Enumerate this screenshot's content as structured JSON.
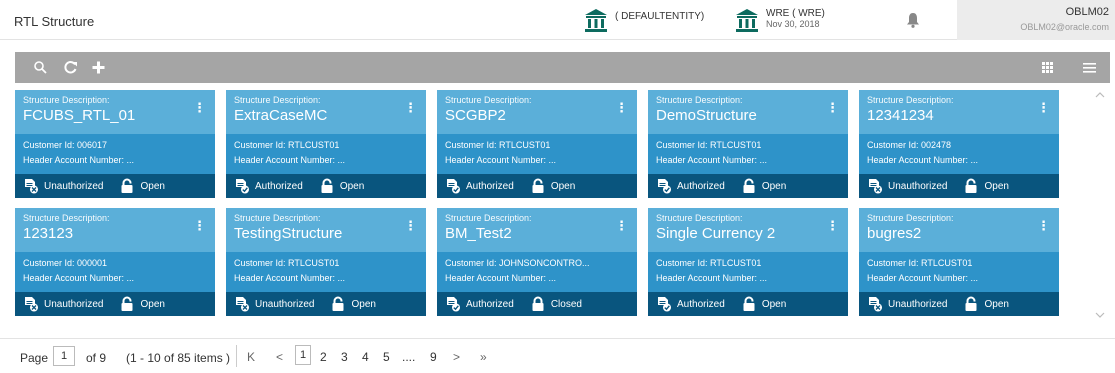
{
  "header": {
    "title": "RTL Structure",
    "entity1": {
      "name": "( DEFAULTENTITY)"
    },
    "entity2": {
      "name": "WRE ( WRE)",
      "date": "Nov 30, 2018"
    },
    "user": {
      "name": "OBLM02",
      "email": "OBLM02@oracle.com"
    }
  },
  "toolbar": {
    "icons": [
      "search-icon",
      "refresh-icon",
      "add-icon",
      "grid-view-icon",
      "list-view-icon"
    ]
  },
  "cards": [
    {
      "label": "Structure Description:",
      "name": "FCUBS_RTL_01",
      "customer": "Customer Id: 006017",
      "account": "Header Account Number: ...",
      "auth": "Unauthorized",
      "status": "Open"
    },
    {
      "label": "Structure Description:",
      "name": "ExtraCaseMC",
      "customer": "Customer Id: RTLCUST01",
      "account": "Header Account Number: ...",
      "auth": "Authorized",
      "status": "Open"
    },
    {
      "label": "Structure Description:",
      "name": "SCGBP2",
      "customer": "Customer Id: RTLCUST01",
      "account": "Header Account Number: ...",
      "auth": "Authorized",
      "status": "Open"
    },
    {
      "label": "Structure Description:",
      "name": "DemoStructure",
      "customer": "Customer Id: RTLCUST01",
      "account": "Header Account Number: ...",
      "auth": "Authorized",
      "status": "Open"
    },
    {
      "label": "Structure Description:",
      "name": "12341234",
      "customer": "Customer Id: 002478",
      "account": "Header Account Number: ...",
      "auth": "Unauthorized",
      "status": "Open"
    },
    {
      "label": "Structure Description:",
      "name": "123123",
      "customer": "Customer Id: 000001",
      "account": "Header Account Number: ...",
      "auth": "Unauthorized",
      "status": "Open"
    },
    {
      "label": "Structure Description:",
      "name": "TestingStructure",
      "customer": "Customer Id: RTLCUST01",
      "account": "Header Account Number: ...",
      "auth": "Unauthorized",
      "status": "Open"
    },
    {
      "label": "Structure Description:",
      "name": "BM_Test2",
      "customer": "Customer Id: JOHNSONCONTRO...",
      "account": "Header Account Number: ...",
      "auth": "Authorized",
      "status": "Closed"
    },
    {
      "label": "Structure Description:",
      "name": "Single Currency 2",
      "customer": "Customer Id: RTLCUST01",
      "account": "Header Account Number: ...",
      "auth": "Authorized",
      "status": "Open"
    },
    {
      "label": "Structure Description:",
      "name": "bugres2",
      "customer": "Customer Id: RTLCUST01",
      "account": "Header Account Number: ...",
      "auth": "Unauthorized",
      "status": "Open"
    }
  ],
  "pager": {
    "page_label": "Page",
    "current": "1",
    "of": "of 9",
    "summary": "(1 - 10 of 85 items )",
    "first": "K",
    "prev": "<",
    "pages": [
      "1",
      "2",
      "3",
      "4",
      "5",
      "....",
      "9"
    ],
    "next": ">",
    "last": "»"
  },
  "colors": {
    "card_top": "#5bafd9",
    "card_mid": "#2e93c9",
    "card_bottom": "#09557e",
    "toolbar": "#a5a5a5",
    "bank_icon": "#0d6b5f"
  }
}
